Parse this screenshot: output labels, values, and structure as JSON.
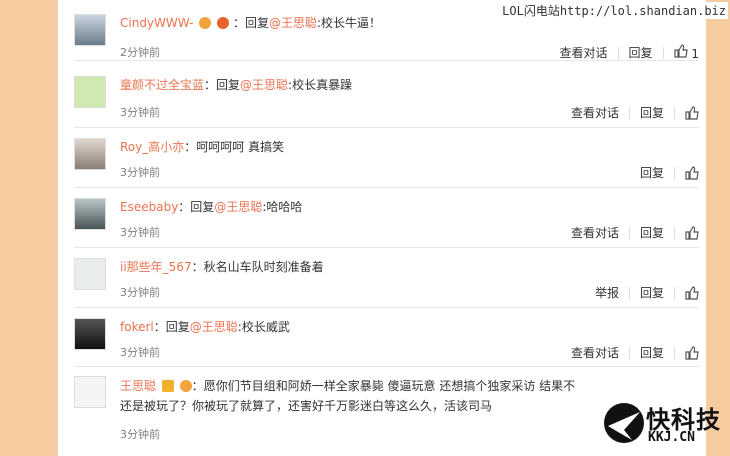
{
  "watermark": "LOL闪电站http://lol.shandian.biz",
  "logo": {
    "main": "快科技",
    "sub": "KKJ.CN"
  },
  "comments": [
    {
      "user": "CindyWWW-",
      "prefix": "：回复",
      "mention": "@王思聪",
      "text": ":校长牛逼！",
      "time": "2分钟前",
      "actions": [
        "查看对话",
        "回复"
      ],
      "likes": "1"
    },
    {
      "user": "童颜不过全宝蓝",
      "prefix": "：回复",
      "mention": "@王思聪",
      "text": ":校长真暴躁",
      "time": "3分钟前",
      "actions": [
        "查看对话",
        "回复"
      ],
      "likes": ""
    },
    {
      "user": "Roy_高小亦",
      "prefix": "：",
      "mention": "",
      "text": "呵呵呵呵 真搞笑",
      "time": "3分钟前",
      "actions": [
        "回复"
      ],
      "likes": ""
    },
    {
      "user": "Eseebaby",
      "prefix": "：回复",
      "mention": "@王思聪",
      "text": ":哈哈哈",
      "time": "3分钟前",
      "actions": [
        "查看对话",
        "回复"
      ],
      "likes": ""
    },
    {
      "user": "ii那些年_567",
      "prefix": "：",
      "mention": "",
      "text": "秋名山车队时刻准备着",
      "time": "3分钟前",
      "actions": [
        "举报",
        "回复"
      ],
      "likes": ""
    },
    {
      "user": "fokerl",
      "prefix": "：回复",
      "mention": "@王思聪",
      "text": ":校长威武",
      "time": "3分钟前",
      "actions": [
        "查看对话",
        "回复"
      ],
      "likes": ""
    },
    {
      "user": "王思聪",
      "prefix": "：",
      "mention": "",
      "text": "愿你们节目组和阿娇一样全家暴毙 傻逼玩意 还想搞个独家采访 结果不还是被玩了？你被玩了就算了，还害好千万影迷白等这么久，活该司马",
      "time": "3分钟前",
      "actions": [],
      "likes": ""
    }
  ]
}
